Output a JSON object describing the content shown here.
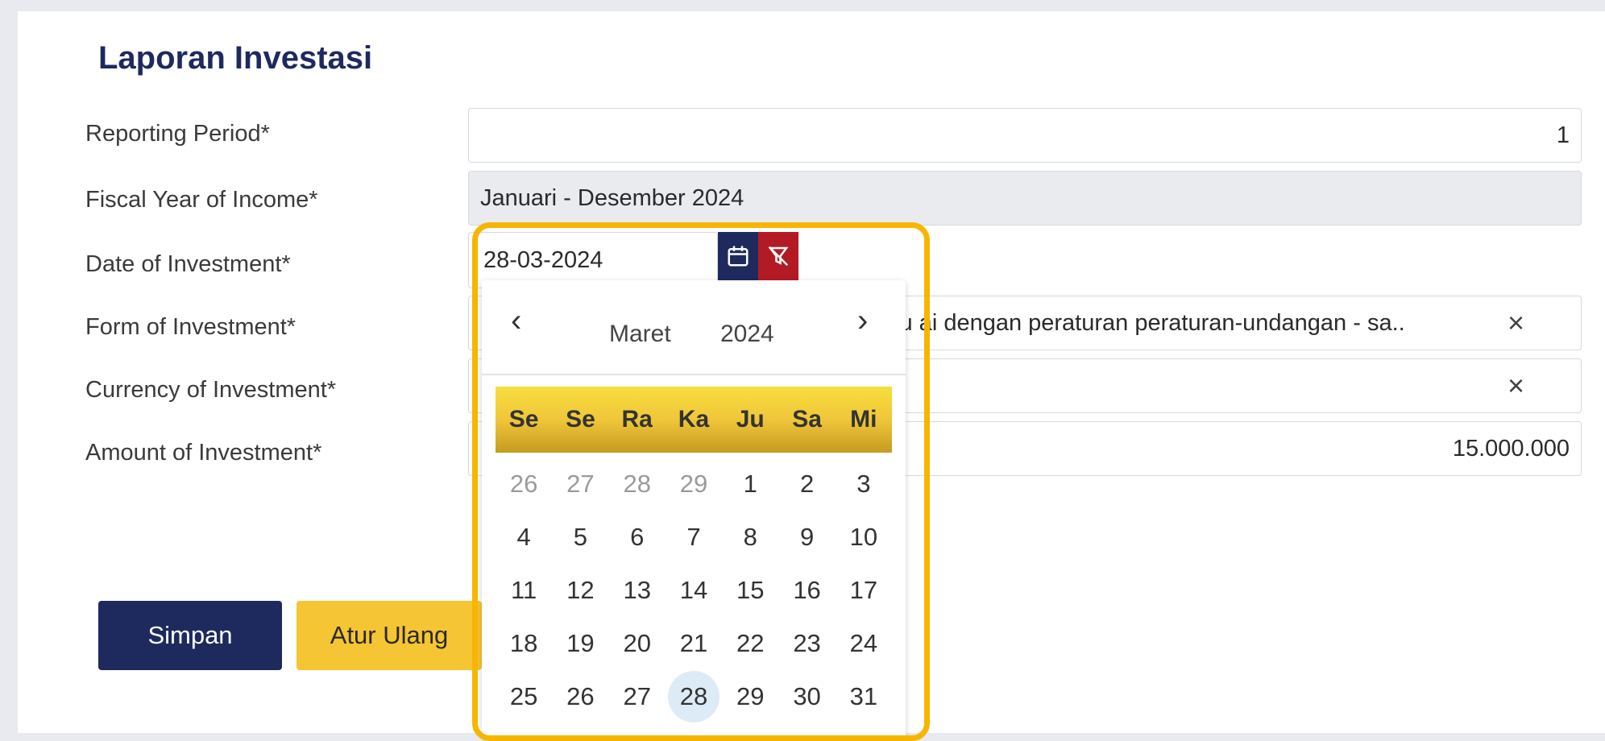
{
  "page": {
    "title": "Laporan Investasi"
  },
  "form": {
    "reporting_period": {
      "label": "Reporting Period*",
      "value": "1"
    },
    "fiscal_year": {
      "label": "Fiscal Year of Income*",
      "value": "Januari - Desember 2024"
    },
    "date_of_investment": {
      "label": "Date of Investment*",
      "value": "28-03-2024"
    },
    "form_of_investment": {
      "label": "Form of Investment*",
      "value_visible": "su ai dengan peraturan peraturan-undangan - sa.."
    },
    "currency_of_investment": {
      "label": "Currency of Investment*",
      "value": ""
    },
    "amount_of_investment": {
      "label": "Amount of Investment*",
      "value": "15.000.000"
    },
    "clear_icon": "×"
  },
  "buttons": {
    "save": "Simpan",
    "reset": "Atur Ulang"
  },
  "datepicker": {
    "prev": "‹",
    "next": "›",
    "month": "Maret",
    "year": "2024",
    "weekdays": [
      "Se",
      "Se",
      "Ra",
      "Ka",
      "Ju",
      "Sa",
      "Mi"
    ],
    "weeks": [
      [
        "26",
        "27",
        "28",
        "29",
        "1",
        "2",
        "3"
      ],
      [
        "4",
        "5",
        "6",
        "7",
        "8",
        "9",
        "10"
      ],
      [
        "11",
        "12",
        "13",
        "14",
        "15",
        "16",
        "17"
      ],
      [
        "18",
        "19",
        "20",
        "21",
        "22",
        "23",
        "24"
      ],
      [
        "25",
        "26",
        "27",
        "28",
        "29",
        "30",
        "31"
      ]
    ],
    "selected_day": "28"
  },
  "colors": {
    "primary": "#1e2a5e",
    "danger": "#b31b24",
    "accent": "#f5c534",
    "highlight": "#f7b500"
  },
  "icons": [
    "calendar-icon",
    "filter-off-icon",
    "close-icon",
    "chevron-left-icon",
    "chevron-right-icon"
  ]
}
